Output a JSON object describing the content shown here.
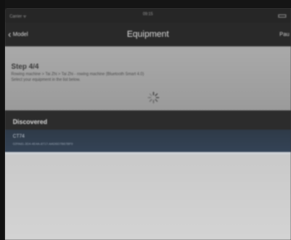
{
  "status_bar": {
    "carrier": "Carrier ᯤ",
    "time": "09:15"
  },
  "nav": {
    "back_label": "Model",
    "title": "Equipment",
    "right_label": "Pau"
  },
  "step": {
    "title": "Step 4/4",
    "path": "Rowing machine > Tai Zhi > Tai Zhi - rowing machine (Bluetooth Smart 4.0)",
    "instruction": "Select your equipment in the list below."
  },
  "discovered": {
    "header": "Discovered",
    "devices": [
      {
        "name": "CT74",
        "id": "02FA81-3D4-4E4A-8717-AAD6D7B67BF9"
      }
    ]
  },
  "icons": {
    "back": "chevron-left-icon",
    "spinner": "activity-spinner-icon"
  }
}
